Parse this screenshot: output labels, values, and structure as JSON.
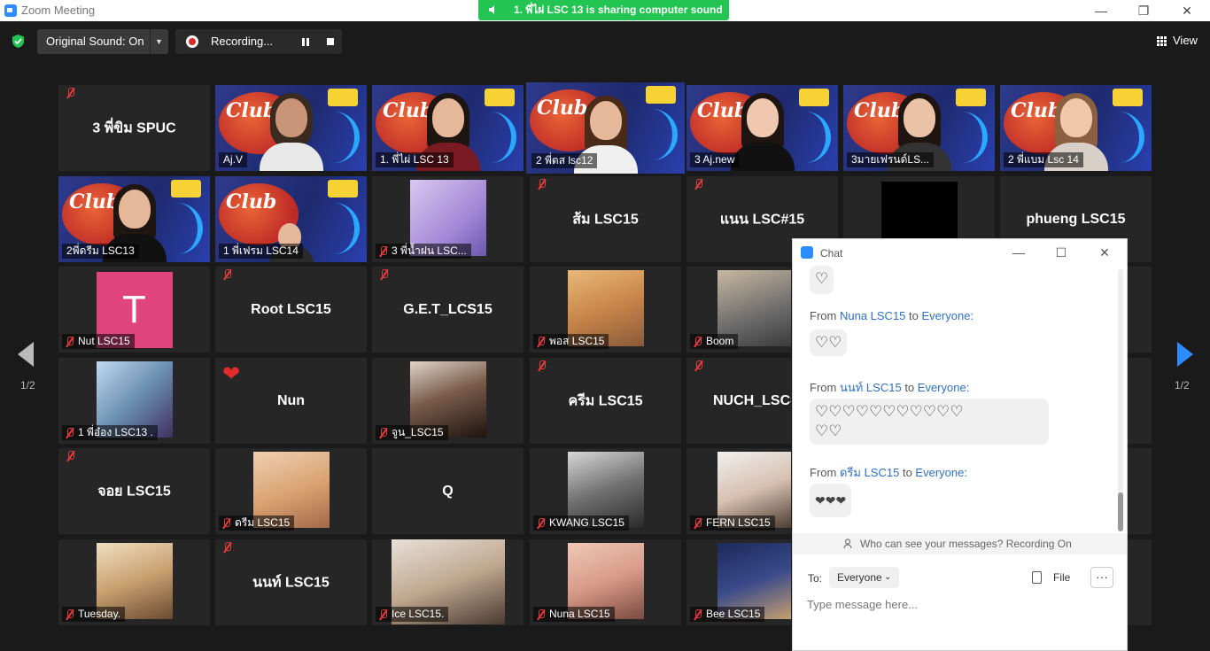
{
  "window": {
    "title": "Zoom Meeting"
  },
  "share_banner": "1. พี่ไผ่ LSC 13 is sharing computer sound",
  "topbar": {
    "original_sound": "Original Sound: On",
    "recording": "Recording...",
    "view": "View"
  },
  "page_indicator": "1/2",
  "tiles": [
    {
      "name": "3 พี่ขิม SPUC"
    },
    {
      "name": "Aj.V"
    },
    {
      "name": "1. พี่ไผ่ LSC 13"
    },
    {
      "name": "2 พี่ตส lsc12"
    },
    {
      "name": "3 Aj.new"
    },
    {
      "name": "3มายเฟรนด์LS..."
    },
    {
      "name": "2 พี่แบม Lsc 14"
    },
    {
      "name": "2พี่ดรีม LSC13"
    },
    {
      "name": "1 พี่เฟรม LSC14"
    },
    {
      "name": "3 พี่น้ำฝน LSC..."
    },
    {
      "name": "ส้ม LSC15"
    },
    {
      "name": "แนน LSC#15"
    },
    {
      "name": ""
    },
    {
      "name": "phueng LSC15"
    },
    {
      "name": "Nut LSC15"
    },
    {
      "name": "Root LSC15"
    },
    {
      "name": "G.E.T_LCS15"
    },
    {
      "name": "พอส LSC15"
    },
    {
      "name": "Boom"
    },
    {
      "name": "1 พี่อ๋อง LSC13 ."
    },
    {
      "name": "Nun"
    },
    {
      "name": "จูน_LSC15"
    },
    {
      "name": "ครีม LSC15"
    },
    {
      "name": "NUCH_LSC#"
    },
    {
      "name": "จอย LSC15"
    },
    {
      "name": "ดรีม LSC15"
    },
    {
      "name": "Q"
    },
    {
      "name": "KWANG LSC15"
    },
    {
      "name": "FERN LSC15"
    },
    {
      "name": "Tuesday."
    },
    {
      "name": "นนท์ LSC15"
    },
    {
      "name": "Ice LSC15."
    },
    {
      "name": "Nuna LSC15"
    },
    {
      "name": "Bee LSC15"
    }
  ],
  "avatar_letter": "T",
  "chat": {
    "title": "Chat",
    "messages": [
      {
        "from_label": "From",
        "sender": "Nuna LSC15",
        "to_label": "to",
        "to": "Everyone:",
        "text": "♡♡"
      },
      {
        "from_label": "From",
        "sender": "นนท์ LSC15",
        "to_label": "to",
        "to": "Everyone:",
        "text": "♡♡♡♡♡♡♡♡♡♡♡",
        "text2": "♡♡"
      },
      {
        "from_label": "From",
        "sender": "ดรีม LSC15",
        "to_label": "to",
        "to": "Everyone:",
        "text": "❤❤❤"
      }
    ],
    "prev_bubble": "♡",
    "who_can_see": "Who can see your messages? Recording On",
    "to_label": "To:",
    "to_value": "Everyone",
    "file_label": "File",
    "input_placeholder": "Type message here..."
  },
  "colors": {
    "active_speaker": "#d6e44b",
    "share_banner": "#23c552",
    "accent": "#2d8cff"
  }
}
